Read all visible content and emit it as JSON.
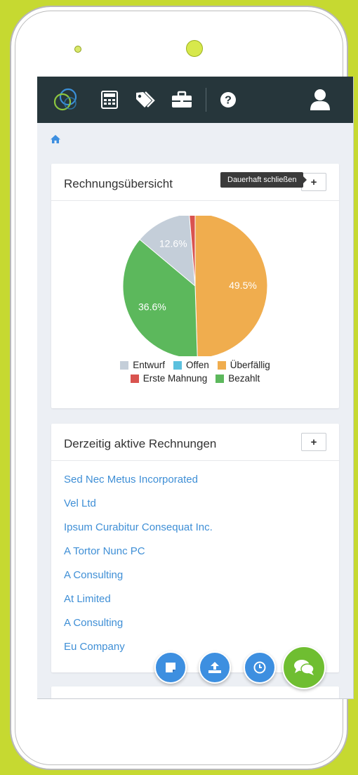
{
  "colors": {
    "accent": "#3d8fe0",
    "topbar": "#26363b",
    "link": "#3f8fd6",
    "chat": "#6fbe31",
    "bezel": "#c6d931"
  },
  "topbar": {
    "icons": [
      "logo-icon",
      "calculator-icon",
      "tags-icon",
      "briefcase-icon",
      "help-icon",
      "user-icon"
    ]
  },
  "breadcrumb": {
    "icon": "home-icon"
  },
  "overview": {
    "title": "Rechnungsübersicht",
    "tooltip": "Dauerhaft schließen",
    "plus_label": "+"
  },
  "chart_data": {
    "type": "pie",
    "slices": [
      {
        "label": "Überfällig",
        "value": 49.5,
        "color": "#f0ad4e",
        "shown_label": "49.5%"
      },
      {
        "label": "Bezahlt",
        "value": 36.6,
        "color": "#5cb85c",
        "shown_label": "36.6%"
      },
      {
        "label": "Entwurf",
        "value": 12.6,
        "color": "#c4ced9",
        "shown_label": "12.6%"
      },
      {
        "label": "Erste Mahnung",
        "value": 1.3,
        "color": "#d9534f",
        "shown_label": ""
      },
      {
        "label": "Offen",
        "value": 0,
        "color": "#5bc0de",
        "shown_label": ""
      }
    ],
    "legend": [
      {
        "label": "Entwurf",
        "color": "#c4ced9"
      },
      {
        "label": "Offen",
        "color": "#5bc0de"
      },
      {
        "label": "Überfällig",
        "color": "#f0ad4e"
      },
      {
        "label": "Erste Mahnung",
        "color": "#d9534f"
      },
      {
        "label": "Bezahlt",
        "color": "#5cb85c"
      }
    ],
    "legend_placement": "bottom"
  },
  "active": {
    "title": "Derzeitig aktive Rechnungen",
    "plus_label": "+",
    "items": [
      "Sed Nec Metus Incorporated",
      "Vel Ltd",
      "Ipsum Curabitur Consequat Inc.",
      "A Tortor Nunc PC",
      "A Consulting",
      "At Limited",
      "A Consulting",
      "Eu Company"
    ]
  },
  "fabs": [
    "note-icon",
    "upload-icon",
    "clock-icon",
    "chat-icon"
  ]
}
